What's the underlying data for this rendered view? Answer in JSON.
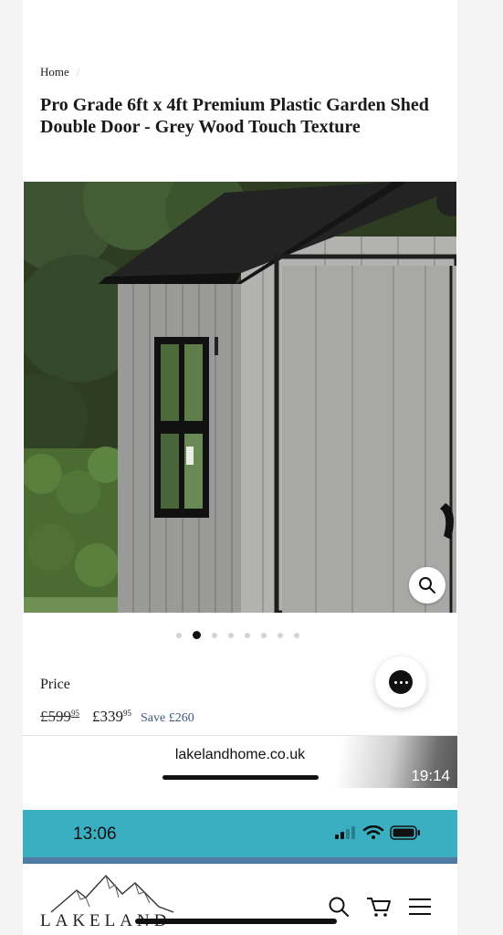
{
  "breadcrumb": {
    "home": "Home",
    "separator": "/"
  },
  "product": {
    "title": "Pro Grade 6ft x 4ft Premium Plastic Garden Shed Double Door - Grey Wood Touch Texture",
    "image_count": 8,
    "active_image": 2
  },
  "price": {
    "label": "Price",
    "old_main": "£599",
    "old_pence": "95",
    "new_main": "£339",
    "new_pence": "95",
    "save": "Save £260"
  },
  "browser": {
    "url": "lakelandhome.co.uk",
    "video_time": "19:14"
  },
  "second_screen": {
    "status_time": "13:06",
    "logo_text": "LAKELAND",
    "status_bar_color": "#3aafc2"
  },
  "icons": [
    "search-icon",
    "cart-icon",
    "menu-icon",
    "chat-icon",
    "zoom-icon",
    "signal-icon",
    "wifi-icon",
    "battery-icon"
  ]
}
